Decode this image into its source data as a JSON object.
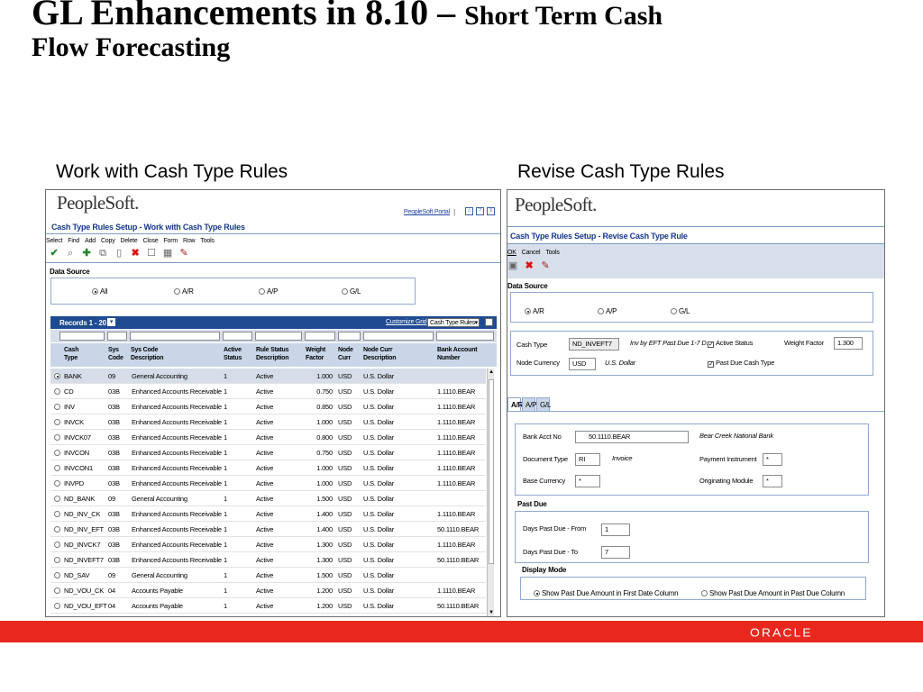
{
  "slide": {
    "title_main": "GL Enhancements in 8.10 – ",
    "title_sub": "Short Term Cash",
    "title_line2": "Flow Forecasting",
    "caption_left": "Work with Cash Type Rules",
    "caption_right": "Revise Cash Type Rules",
    "footer_logo": "ORACLE"
  },
  "left_screen": {
    "logo": "PeopleSoft.",
    "portal_link": "PeopleSoft Portal",
    "page_title": "Cash Type Rules Setup - Work with Cash Type Rules",
    "menu": [
      "Select",
      "Find",
      "Add",
      "Copy",
      "Delete",
      "Close",
      "Form",
      "Row",
      "Tools"
    ],
    "data_source_label": "Data Source",
    "radios": [
      {
        "label": "All",
        "selected": true
      },
      {
        "label": "A/R",
        "selected": false
      },
      {
        "label": "A/P",
        "selected": false
      },
      {
        "label": "G/L",
        "selected": false
      }
    ],
    "grid_records": "Records 1 - 20",
    "customize_grid": "Customize Grid",
    "grid_select": "Cash Type Rules",
    "columns": [
      "Cash\nType",
      "Sys\nCode",
      "Sys Code\nDescription",
      "Active\nStatus",
      "Rule Status\nDescription",
      "Weight\nFactor",
      "Node\nCurr",
      "Node Curr\nDescription",
      "Bank Account\nNumber"
    ],
    "rows": [
      [
        "BANK",
        "09",
        "General Accounting",
        "1",
        "Active",
        "1.000",
        "USD",
        "U.S. Dollar",
        ""
      ],
      [
        "CD",
        "03B",
        "Enhanced Accounts Receivable",
        "1",
        "Active",
        "0.750",
        "USD",
        "U.S. Dollar",
        "1.1110.BEAR"
      ],
      [
        "INV",
        "03B",
        "Enhanced Accounts Receivable",
        "1",
        "Active",
        "0.850",
        "USD",
        "U.S. Dollar",
        "1.1110.BEAR"
      ],
      [
        "INVCK",
        "03B",
        "Enhanced Accounts Receivable",
        "1",
        "Active",
        "1.000",
        "USD",
        "U.S. Dollar",
        "1.1110.BEAR"
      ],
      [
        "INVCK07",
        "03B",
        "Enhanced Accounts Receivable",
        "1",
        "Active",
        "0.800",
        "USD",
        "U.S. Dollar",
        "1.1110.BEAR"
      ],
      [
        "INVCON",
        "03B",
        "Enhanced Accounts Receivable",
        "1",
        "Active",
        "0.750",
        "USD",
        "U.S. Dollar",
        "1.1110.BEAR"
      ],
      [
        "INVCON1",
        "03B",
        "Enhanced Accounts Receivable",
        "1",
        "Active",
        "1.000",
        "USD",
        "U.S. Dollar",
        "1.1110.BEAR"
      ],
      [
        "INVPD",
        "03B",
        "Enhanced Accounts Receivable",
        "1",
        "Active",
        "1.000",
        "USD",
        "U.S. Dollar",
        "1.1110.BEAR"
      ],
      [
        "ND_BANK",
        "09",
        "General Accounting",
        "1",
        "Active",
        "1.500",
        "USD",
        "U.S. Dollar",
        ""
      ],
      [
        "ND_INV_CK",
        "03B",
        "Enhanced Accounts Receivable",
        "1",
        "Active",
        "1.400",
        "USD",
        "U.S. Dollar",
        "1.1110.BEAR"
      ],
      [
        "ND_INV_EFT",
        "03B",
        "Enhanced Accounts Receivable",
        "1",
        "Active",
        "1.400",
        "USD",
        "U.S. Dollar",
        "50.1110.BEAR"
      ],
      [
        "ND_INVCK7",
        "03B",
        "Enhanced Accounts Receivable",
        "1",
        "Active",
        "1.300",
        "USD",
        "U.S. Dollar",
        "1.1110.BEAR"
      ],
      [
        "ND_INVEFT7",
        "03B",
        "Enhanced Accounts Receivable",
        "1",
        "Active",
        "1.300",
        "USD",
        "U.S. Dollar",
        "50.1110.BEAR"
      ],
      [
        "ND_SAV",
        "09",
        "General Accounting",
        "1",
        "Active",
        "1.500",
        "USD",
        "U.S. Dollar",
        ""
      ],
      [
        "ND_VOU_CK",
        "04",
        "Accounts Payable",
        "1",
        "Active",
        "1.200",
        "USD",
        "U.S. Dollar",
        "1.1110.BEAR"
      ],
      [
        "ND_VOU_EFT",
        "04",
        "Accounts Payable",
        "1",
        "Active",
        "1.200",
        "USD",
        "U.S. Dollar",
        "50.1110.BEAR"
      ]
    ]
  },
  "right_screen": {
    "logo": "PeopleSoft.",
    "page_title": "Cash Type Rules Setup - Revise Cash Type Rule",
    "menu": [
      "OK",
      "Cancel",
      "Tools"
    ],
    "data_source_label": "Data Source",
    "radios": [
      {
        "label": "A/R",
        "selected": true
      },
      {
        "label": "A/P",
        "selected": false
      },
      {
        "label": "G/L",
        "selected": false
      }
    ],
    "cash_type_label": "Cash Type",
    "cash_type_value": "ND_INVEFT7",
    "cash_type_desc": "Inv by EFT Past Due 1-7 D.",
    "active_status_label": "Active Status",
    "weight_factor_label": "Weight Factor",
    "weight_factor_value": "1.300",
    "node_currency_label": "Node Currency",
    "node_currency_value": "USD",
    "node_currency_desc": "U.S. Dollar",
    "past_due_cash_type_label": "Past Due Cash Type",
    "tabs": [
      "A/R",
      "A/P",
      "G/L"
    ],
    "bank_acct_label": "Bank Acct No",
    "bank_acct_value": "50.1110.BEAR",
    "bank_acct_desc": "Bear Creek National Bank",
    "document_type_label": "Document Type",
    "document_type_value": "RI",
    "document_type_desc": "Invoice",
    "payment_instrument_label": "Payment Instrument",
    "payment_instrument_value": "*",
    "base_currency_label": "Base Currency",
    "base_currency_value": "*",
    "originating_module_label": "Originating Module",
    "originating_module_value": "*",
    "past_due_label": "Past Due",
    "days_from_label": "Days Past Due - From",
    "days_from_value": "1",
    "days_to_label": "Days Past Due - To",
    "days_to_value": "7",
    "display_mode_label": "Display Mode",
    "display_mode_opt1": "Show Past Due Amount in First Date Column",
    "display_mode_opt2": "Show Past Due Amount in Past Due Column"
  }
}
